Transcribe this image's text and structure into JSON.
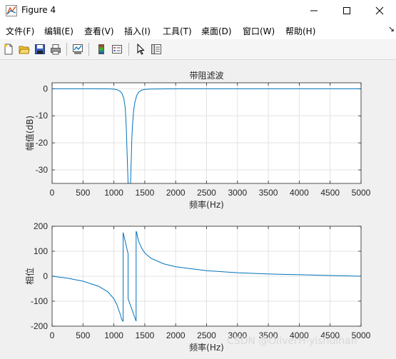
{
  "window": {
    "title": "Figure 4",
    "minimize_icon": "minimize-icon",
    "maximize_icon": "maximize-icon",
    "close_icon": "close-icon"
  },
  "menu": {
    "items": [
      "文件(F)",
      "编辑(E)",
      "查看(V)",
      "插入(I)",
      "工具(T)",
      "桌面(D)",
      "窗口(W)",
      "帮助(H)"
    ],
    "overflow_icon": "arrow-icon"
  },
  "toolbar": {
    "icons": [
      "new-figure-icon",
      "open-file-icon",
      "save-icon",
      "print-icon",
      "link-plot-icon",
      "colorbar-icon",
      "legend-icon",
      "edit-plot-icon",
      "property-inspector-icon"
    ]
  },
  "watermark": "CSDN @OliverH-yishuihan",
  "chart_data": [
    {
      "type": "line",
      "title": "带阻滤波",
      "xlabel": "频率(Hz)",
      "ylabel": "幅值(dB)",
      "xlim": [
        0,
        5000
      ],
      "ylim": [
        -35,
        2.2
      ],
      "xticks": [
        "0",
        "500",
        "1000",
        "1500",
        "2000",
        "2500",
        "3000",
        "3500",
        "4000",
        "4500",
        "5000"
      ],
      "yticks": [
        "-30",
        "-20",
        "-10",
        "0"
      ],
      "grid": true,
      "color": "#0072bd",
      "x": [
        0,
        500,
        900,
        1000,
        1050,
        1100,
        1130,
        1160,
        1180,
        1190,
        1200,
        1210,
        1230,
        1250,
        1260,
        1270,
        1280,
        1290,
        1300,
        1320,
        1340,
        1370,
        1400,
        1450,
        1500,
        1600,
        2000,
        3000,
        4000,
        5000
      ],
      "y": [
        0,
        0,
        -0.05,
        -0.15,
        -0.35,
        -0.9,
        -1.7,
        -3.5,
        -6.5,
        -9.5,
        -14,
        -21,
        -35,
        -35,
        -35,
        -35,
        -27,
        -19,
        -14,
        -8,
        -5,
        -2.5,
        -1.3,
        -0.5,
        -0.25,
        -0.1,
        0,
        0,
        0,
        0
      ]
    },
    {
      "type": "line",
      "title": "",
      "xlabel": "频率(Hz)",
      "ylabel": "相位",
      "xlim": [
        0,
        5000
      ],
      "ylim": [
        -200,
        200
      ],
      "xticks": [
        "0",
        "500",
        "1000",
        "1500",
        "2000",
        "2500",
        "3000",
        "3500",
        "4000",
        "4500",
        "5000"
      ],
      "yticks": [
        "-200",
        "-100",
        "0",
        "100",
        "200"
      ],
      "grid": true,
      "color": "#0072bd",
      "x": [
        0,
        250,
        500,
        750,
        900,
        1000,
        1050,
        1100,
        1130,
        1150,
        1150,
        1230,
        1230,
        1360,
        1360,
        1370,
        1380,
        1400,
        1450,
        1500,
        1600,
        1800,
        2000,
        2500,
        3000,
        3500,
        4000,
        4500,
        5000
      ],
      "y": [
        0,
        -8,
        -20,
        -40,
        -62,
        -90,
        -115,
        -150,
        -175,
        -180,
        175,
        90,
        -90,
        -180,
        180,
        175,
        160,
        140,
        112,
        93,
        72,
        50,
        38,
        22,
        14,
        9,
        6,
        3,
        0
      ]
    }
  ]
}
